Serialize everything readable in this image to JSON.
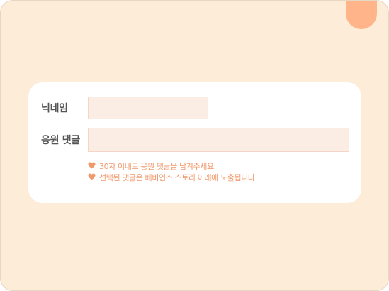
{
  "form": {
    "nickname_label": "닉네임",
    "nickname_value": "",
    "comment_label": "응원 댓글",
    "comment_value": ""
  },
  "notes": [
    {
      "icon": "heart-icon",
      "text": "30자 이내로 응원 댓글을 남겨주세요."
    },
    {
      "icon": "heart-icon",
      "text": "선택된 댓글은 베비언스 스토리 아래에 노출됩니다."
    }
  ],
  "colors": {
    "background": "#fcecd8",
    "accent": "#ffb48a",
    "note_text": "#f0996b",
    "input_fill": "#fbece4"
  }
}
